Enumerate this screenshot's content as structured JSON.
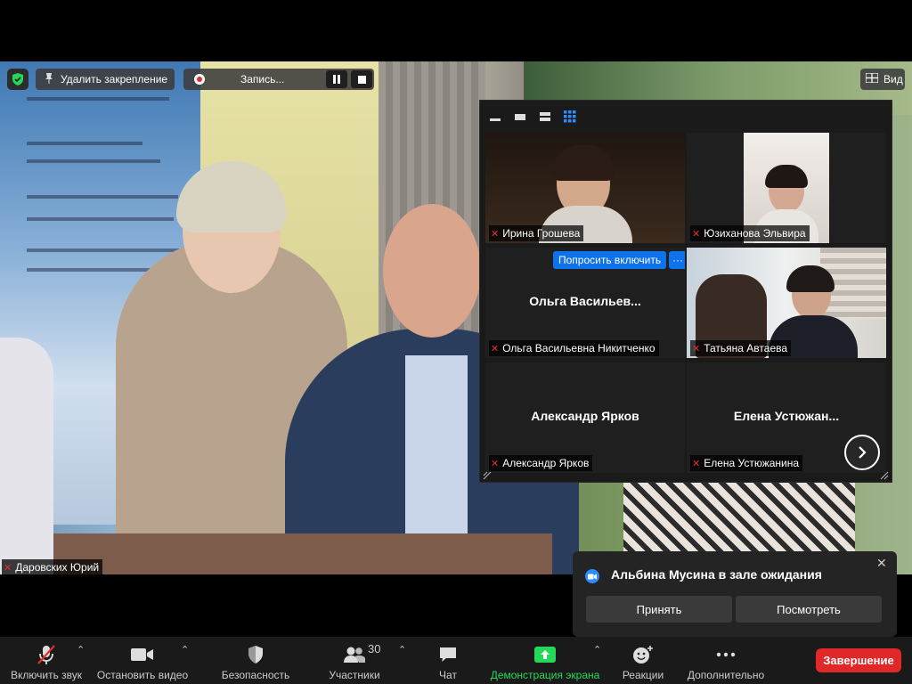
{
  "top_controls": {
    "unpin_label": "Удалить закрепление",
    "recording_label": "Запись...",
    "view_label": "Вид"
  },
  "main_video": {
    "speaker_name": "Даровских Юрий"
  },
  "gallery": {
    "ask_unmute_label": "Попросить включить",
    "more_label": "···",
    "tiles": [
      {
        "name": "Ирина Грошева",
        "big_name": ""
      },
      {
        "name": "Юзиханова Эльвира",
        "big_name": ""
      },
      {
        "name": "Ольга Васильевна Никитченко",
        "big_name": "Ольга  Васильев..."
      },
      {
        "name": "Татьяна Автаева",
        "big_name": ""
      },
      {
        "name": "Александр Ярков",
        "big_name": "Александр Ярков"
      },
      {
        "name": "Елена Устюжанина",
        "big_name": "Елена  Устюжан..."
      }
    ]
  },
  "waiting_room": {
    "title": "Альбина Мусина в зале ожидания",
    "admit_label": "Принять",
    "see_label": "Посмотреть"
  },
  "toolbar": {
    "unmute_label": "Включить звук",
    "stop_video_label": "Остановить видео",
    "security_label": "Безопасность",
    "participants_label": "Участники",
    "participants_count": "30",
    "chat_label": "Чат",
    "share_label": "Демонстрация экрана",
    "reactions_label": "Реакции",
    "more_label": "Дополнительно",
    "end_label": "Завершение"
  },
  "colors": {
    "accent_blue": "#0e72ed",
    "share_green": "#23d959",
    "end_red": "#e02828",
    "mute_red": "#e0312f"
  }
}
